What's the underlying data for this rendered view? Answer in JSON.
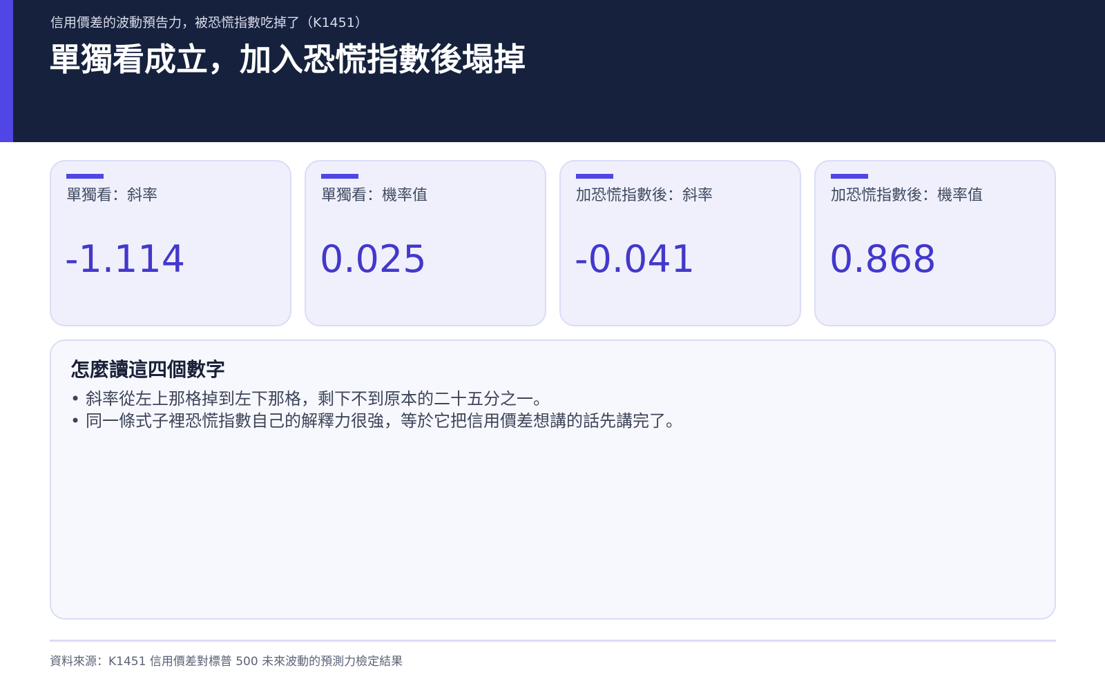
{
  "header": {
    "subtitle": "信用價差的波動預告力，被恐慌指數吃掉了（K1451）",
    "title": "單獨看成立，加入恐慌指數後塌掉"
  },
  "cards": [
    {
      "label": "單獨看：斜率",
      "value": "-1.114"
    },
    {
      "label": "單獨看：機率值",
      "value": "0.025"
    },
    {
      "label": "加恐慌指數後：斜率",
      "value": "-0.041"
    },
    {
      "label": "加恐慌指數後：機率值",
      "value": "0.868"
    }
  ],
  "notes": {
    "title": "怎麼讀這四個數字",
    "bullet_glyph": "•",
    "items": [
      "斜率從左上那格掉到左下那格，剩下不到原本的二十五分之一。",
      "同一條式子裡恐慌指數自己的解釋力很強，等於它把信用價差想講的話先講完了。"
    ]
  },
  "footer": {
    "source": "資料來源：K1451 信用價差對標普 500 未來波動的預測力檢定結果"
  },
  "colors": {
    "header_bg": "#16213d",
    "accent": "#4f46e5",
    "value_text": "#4338ca",
    "card_bg": "#eff0fc",
    "card_border": "#dadcf6"
  }
}
